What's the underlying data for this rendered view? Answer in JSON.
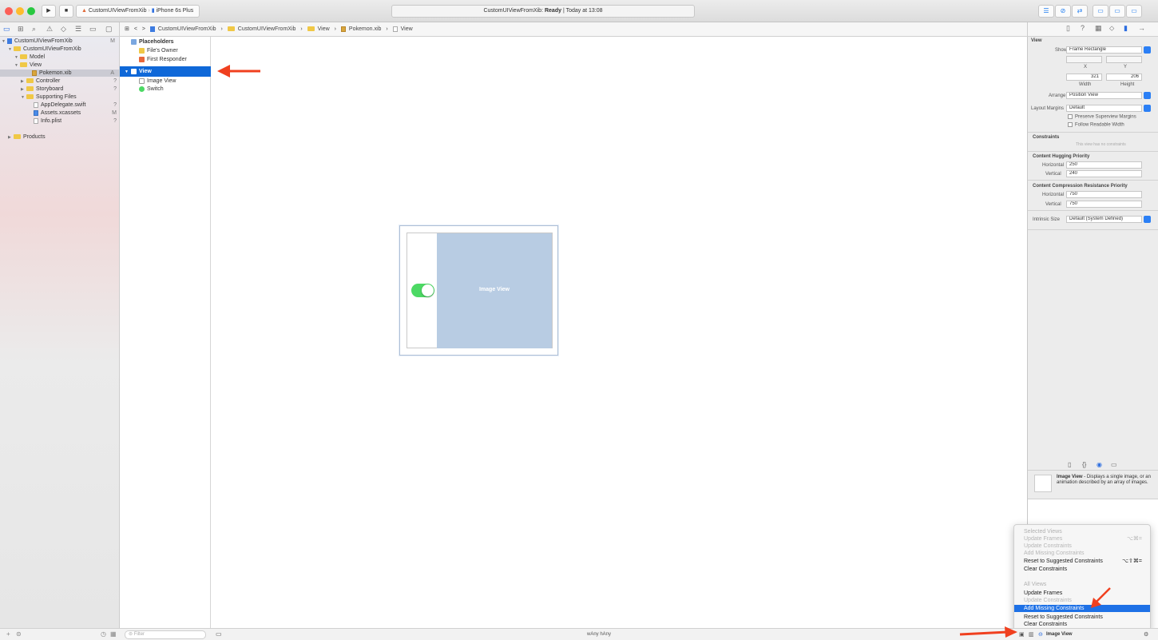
{
  "toolbar": {
    "scheme": "CustomUIViewFromXib",
    "device": "iPhone 6s Plus",
    "status_project": "CustomUIViewFromXib",
    "status_state": "Ready",
    "status_time": "Today at 13:08",
    "play_icon": "▶",
    "stop_icon": "■",
    "editor_buttons": [
      "☰",
      "⊘",
      "⇄",
      "▭",
      "▭",
      "▭"
    ]
  },
  "navigator_bar_icons": [
    "▭",
    "⊞",
    "⌕",
    "⚠",
    "◇",
    "☰",
    "▭",
    "▢"
  ],
  "jumpbar": {
    "items": [
      "⊞",
      "<",
      ">",
      "CustomUIViewFromXib",
      "CustomUIViewFromXib",
      "View",
      "Pokemon.xib",
      "View"
    ]
  },
  "inspector_bar_icons": [
    "▯",
    "?",
    "▦",
    "⬦",
    "▮",
    "→"
  ],
  "navigator": {
    "items": [
      {
        "label": "CustomUIViewFromXib",
        "badge": "M"
      },
      {
        "label": "CustomUIViewFromXib",
        "badge": ""
      },
      {
        "label": "Model",
        "badge": ""
      },
      {
        "label": "View",
        "badge": ""
      },
      {
        "label": "Pokemon.xib",
        "badge": "A"
      },
      {
        "label": "Controller",
        "badge": "?"
      },
      {
        "label": "Storyboard",
        "badge": "?"
      },
      {
        "label": "Supporting Files",
        "badge": ""
      },
      {
        "label": "AppDelegate.swift",
        "badge": "?"
      },
      {
        "label": "Assets.xcassets",
        "badge": "M"
      },
      {
        "label": "Info.plist",
        "badge": "?"
      },
      {
        "label": "Products",
        "badge": ""
      }
    ]
  },
  "outline": {
    "placeholders": "Placeholders",
    "files_owner": "File's Owner",
    "first_responder": "First Responder",
    "view": "View",
    "image_view": "Image View",
    "switch": "Switch"
  },
  "canvas": {
    "image_view_label": "Image View",
    "switch_on": true,
    "size_class": "wAny hAny"
  },
  "inspector": {
    "view_section": "View",
    "show_label": "Show",
    "show_value": "Frame Rectangle",
    "x_label": "X",
    "y_label": "Y",
    "width_value": "321",
    "height_value": "206",
    "width_label": "Width",
    "height_label": "Height",
    "arrange_label": "Arrange",
    "arrange_value": "Position View",
    "layout_margins_label": "Layout Margins",
    "layout_margins_value": "Default",
    "preserve_label": "Preserve Superview Margins",
    "follow_label": "Follow Readable Width",
    "constraints_title": "Constraints",
    "constraints_note": "This view has no constraints",
    "hugging_title": "Content Hugging Priority",
    "horizontal_label": "Horizontal",
    "vertical_label": "Vertical",
    "hugging_h": "250",
    "hugging_v": "240",
    "compression_title": "Content Compression Resistance Priority",
    "compression_h": "750",
    "compression_v": "750",
    "intrinsic_label": "Intrinsic Size",
    "intrinsic_value": "Default (System Defined)"
  },
  "library": {
    "tabs": [
      "▯",
      "{}",
      "◉",
      "▭"
    ],
    "item_title": "Image View",
    "item_desc": " - Displays a single image, or an animation described by an array of images."
  },
  "menu": {
    "selected_views": "Selected Views",
    "items_selected": [
      {
        "label": "Update Frames",
        "shortcut": "⌥⌘=",
        "disabled": true
      },
      {
        "label": "Update Constraints",
        "shortcut": "",
        "disabled": true
      },
      {
        "label": "Add Missing Constraints",
        "shortcut": "",
        "disabled": true
      },
      {
        "label": "Reset to Suggested Constraints",
        "shortcut": "⌥⇧⌘=",
        "disabled": false
      },
      {
        "label": "Clear Constraints",
        "shortcut": "",
        "disabled": false
      }
    ],
    "all_views": "All Views",
    "items_all": [
      {
        "label": "Update Frames",
        "disabled": false
      },
      {
        "label": "Update Constraints",
        "disabled": true
      },
      {
        "label": "Add Missing Constraints",
        "disabled": false,
        "highlighted": true
      },
      {
        "label": "Reset to Suggested Constraints",
        "disabled": false
      },
      {
        "label": "Clear Constraints",
        "disabled": false
      }
    ]
  },
  "bottombar": {
    "filter_placeholder": "Filter",
    "selected_item": "Image View"
  },
  "colors": {
    "selection": "#0f68d8",
    "image_view_fill": "#b8cce3",
    "switch_on": "#4cd964",
    "arrow": "#f0401f",
    "menu_highlight": "#1e71e6"
  }
}
